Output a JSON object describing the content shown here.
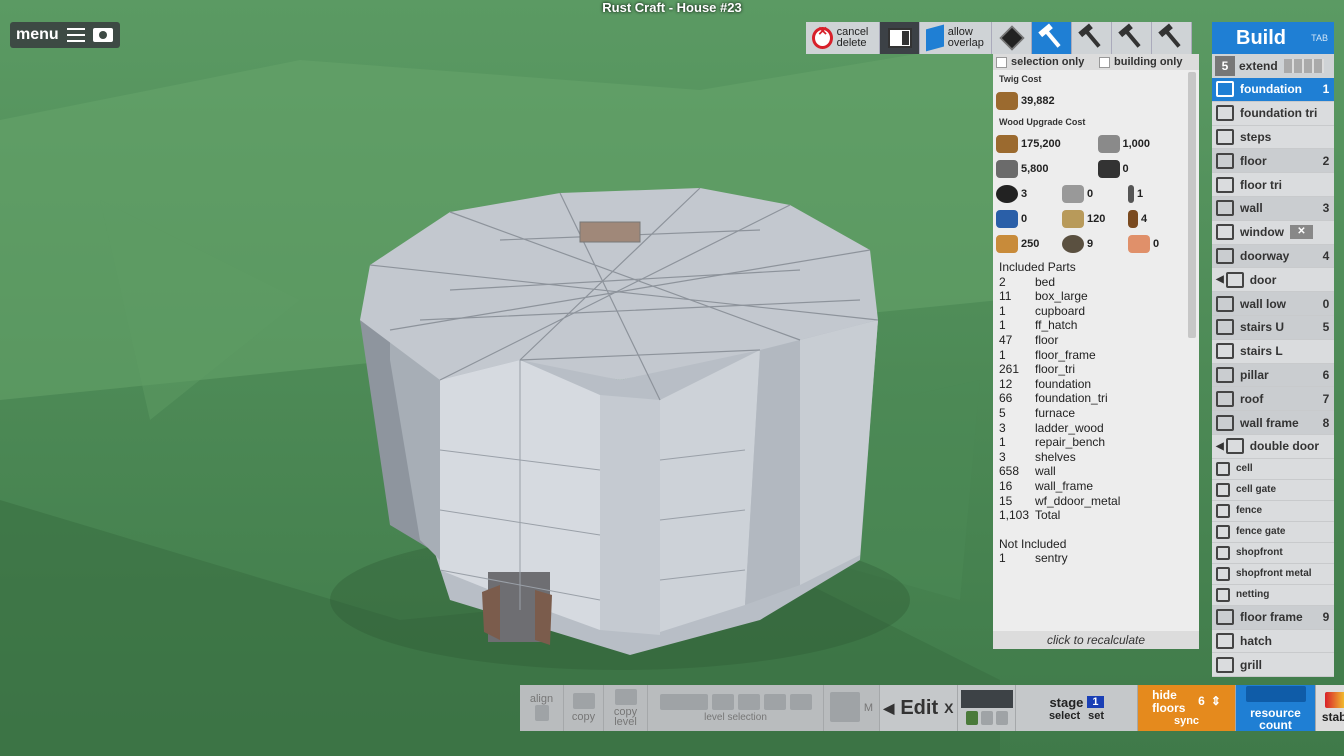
{
  "title": "Rust Craft - House #23",
  "menu": {
    "label": "menu"
  },
  "toolbar": {
    "cancel_delete": "cancel delete",
    "allow_overlap": "allow overlap"
  },
  "cost": {
    "selection_only": "selection only",
    "building_only": "building only",
    "twig_heading": "Twig Cost",
    "twig_value": "39,882",
    "wood_heading": "Wood Upgrade Cost",
    "resources": [
      [
        "175,200",
        "1,000"
      ],
      [
        "5,800",
        "0"
      ],
      [
        "3",
        "0",
        "1"
      ],
      [
        "0",
        "120",
        "4"
      ],
      [
        "250",
        "9",
        "0"
      ]
    ],
    "included_heading": "Included Parts",
    "parts": [
      [
        "2",
        "bed"
      ],
      [
        "11",
        "box_large"
      ],
      [
        "1",
        "cupboard"
      ],
      [
        "1",
        "ff_hatch"
      ],
      [
        "47",
        "floor"
      ],
      [
        "1",
        "floor_frame"
      ],
      [
        "261",
        "floor_tri"
      ],
      [
        "12",
        "foundation"
      ],
      [
        "66",
        "foundation_tri"
      ],
      [
        "5",
        "furnace"
      ],
      [
        "3",
        "ladder_wood"
      ],
      [
        "1",
        "repair_bench"
      ],
      [
        "3",
        "shelves"
      ],
      [
        "658",
        "wall"
      ],
      [
        "16",
        "wall_frame"
      ],
      [
        "15",
        "wf_ddoor_metal"
      ],
      [
        "1,103",
        "Total"
      ]
    ],
    "not_included_heading": "Not Included",
    "not_included": [
      [
        "1",
        "sentry"
      ]
    ],
    "recalc": "click to recalculate"
  },
  "build": {
    "header": "Build",
    "tab_hint": "TAB",
    "extend_num": "5",
    "extend_label": "extend",
    "items": [
      {
        "label": "foundation",
        "key": "1"
      },
      {
        "label": "foundation tri",
        "key": ""
      },
      {
        "label": "steps",
        "key": ""
      },
      {
        "label": "floor",
        "key": "2"
      },
      {
        "label": "floor tri",
        "key": ""
      },
      {
        "label": "wall",
        "key": "3"
      },
      {
        "label": "window",
        "key": ""
      },
      {
        "label": "doorway",
        "key": "4"
      },
      {
        "label": "door",
        "key": ""
      },
      {
        "label": "wall low",
        "key": "0"
      },
      {
        "label": "stairs U",
        "key": "5"
      },
      {
        "label": "stairs L",
        "key": ""
      },
      {
        "label": "pillar",
        "key": "6"
      },
      {
        "label": "roof",
        "key": "7"
      },
      {
        "label": "wall frame",
        "key": "8"
      },
      {
        "label": "double door",
        "key": ""
      },
      {
        "label": "cell",
        "key": ""
      },
      {
        "label": "cell gate",
        "key": ""
      },
      {
        "label": "fence",
        "key": ""
      },
      {
        "label": "fence gate",
        "key": ""
      },
      {
        "label": "shopfront",
        "key": ""
      },
      {
        "label": "shopfront metal",
        "key": ""
      },
      {
        "label": "netting",
        "key": ""
      },
      {
        "label": "floor frame",
        "key": "9"
      },
      {
        "label": "hatch",
        "key": ""
      },
      {
        "label": "grill",
        "key": ""
      }
    ]
  },
  "bottom": {
    "align": "align",
    "copy": "copy",
    "copy_level": "copy level",
    "level_selection": "level selection",
    "m": "M",
    "edit": "Edit",
    "edit_x": "X",
    "stage": "stage",
    "stage_num": "1",
    "select": "select",
    "set": "set",
    "hide_floors": "hide floors",
    "hide_num": "6",
    "sync": "sync",
    "resource_count": "resource count",
    "stability": "stability"
  }
}
